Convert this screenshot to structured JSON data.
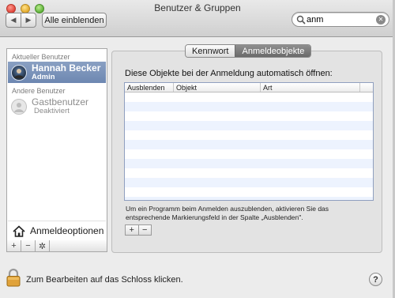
{
  "window": {
    "title": "Benutzer & Gruppen"
  },
  "toolbar": {
    "back_icon": "chevron-left-icon",
    "forward_icon": "chevron-right-icon",
    "show_all_label": "Alle einblenden",
    "search": {
      "value": "anm",
      "icon": "search-icon"
    }
  },
  "sidebar": {
    "current_section": "Aktueller Benutzer",
    "current_user": {
      "name": "Hannah Becker",
      "role": "Admin"
    },
    "other_section": "Andere Benutzer",
    "guest_user": {
      "name": "Gastbenutzer",
      "role": "Deaktiviert"
    },
    "login_options_label": "Anmeldeoptionen",
    "add_label": "+",
    "remove_label": "−",
    "gear_icon": "gear-icon"
  },
  "tabs": [
    {
      "label": "Kennwort",
      "active": false
    },
    {
      "label": "Anmeldeobjekte",
      "active": true
    }
  ],
  "main": {
    "instruction": "Diese Objekte bei der Anmeldung automatisch öffnen:",
    "columns": [
      "Ausblenden",
      "Objekt",
      "Art"
    ],
    "rows": [],
    "hint": "Um ein Programm beim Anmelden auszublenden, aktivieren Sie das entsprechende Markierungsfeld in der Spalte „Ausblenden\".",
    "add_label": "+",
    "remove_label": "−"
  },
  "footer": {
    "lock_text": "Zum Bearbeiten auf das Schloss klicken.",
    "help_label": "?"
  },
  "colors": {
    "selection": "#7890b8",
    "row_alt": "#edf3fe"
  }
}
